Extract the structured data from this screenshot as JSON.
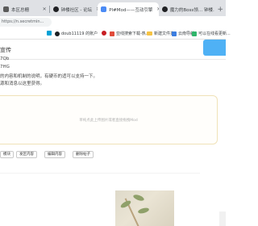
{
  "tabs": [
    {
      "title": "本区总栅",
      "fav_color": "#5a5a5a",
      "active": false
    },
    {
      "title": "钟楼社区 - 论坛",
      "fav_color": "#202124",
      "active": false
    },
    {
      "title": "Pl#Mod——互动引擎",
      "fav_color": "#4b8bf5",
      "active": true
    },
    {
      "title": "魔力的Boss领… 钟楼…",
      "fav_color": "#202124",
      "active": false
    }
  ],
  "address_bar": {
    "url": "https://n.secretmin..."
  },
  "bookmarks": [
    {
      "label": "",
      "icon": "bilibili-icon",
      "color": "#00a1d6"
    },
    {
      "label": "doub11119 的账户",
      "icon": "github-icon",
      "color": "#1b1f23"
    },
    {
      "label": "",
      "icon": "gitee-icon",
      "color": "#c71d23"
    },
    {
      "label": "亚线搜索下载-热...",
      "icon": "app-icon",
      "color": "#e04b3a"
    },
    {
      "label": "新建文件夹",
      "icon": "folder-icon",
      "color": "#f6c344"
    },
    {
      "label": "云南导航",
      "icon": "app-icon",
      "color": "#3b7de0"
    },
    {
      "label": "可以在线看更新...",
      "icon": "app-icon",
      "color": "#2fb56a"
    }
  ],
  "page": {
    "title": "宣传",
    "lines": [
      "7Qb",
      "7HG",
      "的内容和机制的说明，有硬币的适可以支持一下。",
      "源和消息以这里获得。"
    ],
    "upload_hint": "单纯点此上传图片或者直接拖拽Mod",
    "buttons": [
      "模块",
      "发区内容",
      "编辑内容",
      "删除帖子"
    ]
  }
}
